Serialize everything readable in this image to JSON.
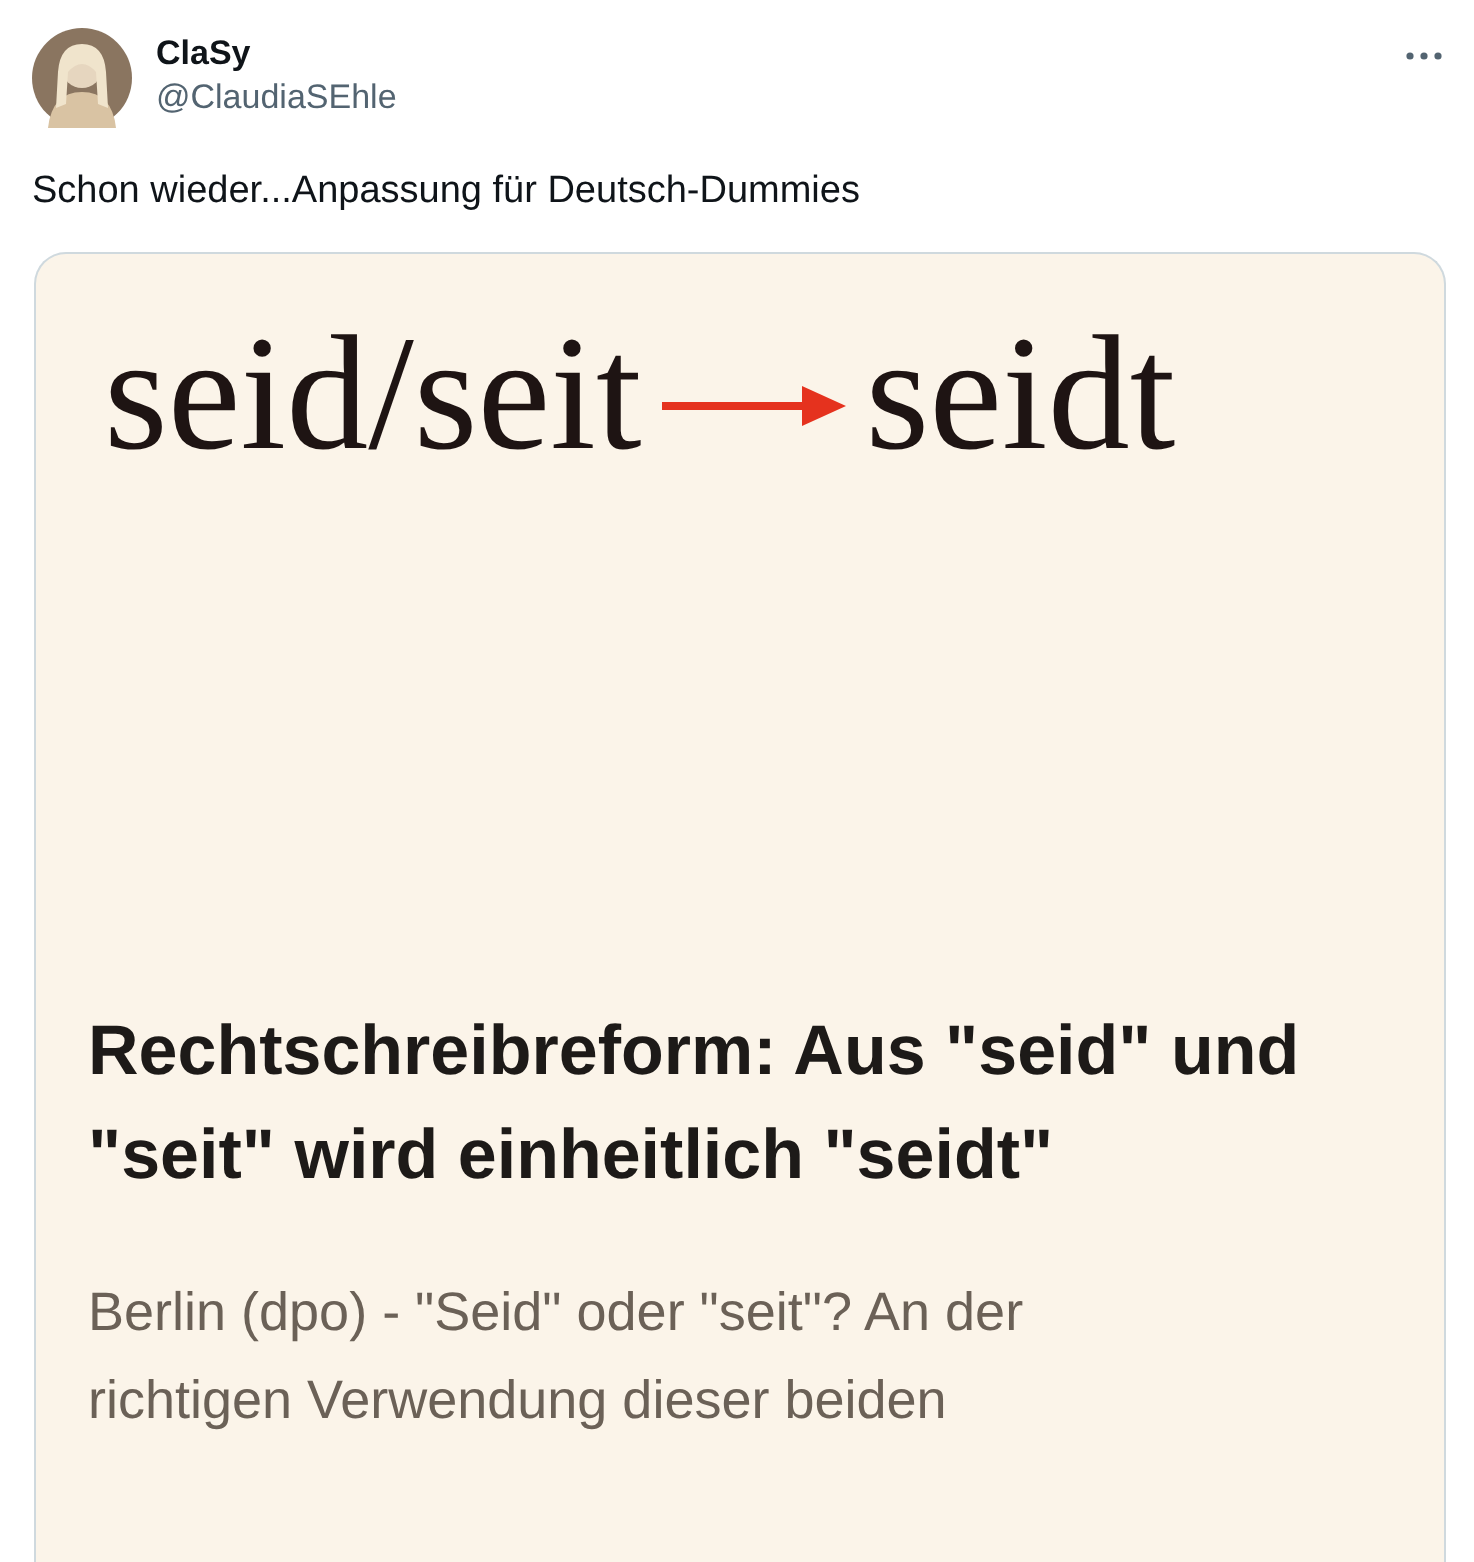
{
  "author": {
    "name": "ClaSy",
    "handle": "@ClaudiaSEhle"
  },
  "tweet_text": "Schon wieder...Anpassung für Deutsch-Dummies",
  "media": {
    "header_left": "seid/seit",
    "header_right": "seidt",
    "headline": "Rechtschreibreform: Aus \"seid\" und \"seit\" wird einheitlich \"seidt\"",
    "body": "Berlin (dpo) - \"Seid\" oder \"seit\"? An der richtigen Verwendung dieser beiden"
  }
}
